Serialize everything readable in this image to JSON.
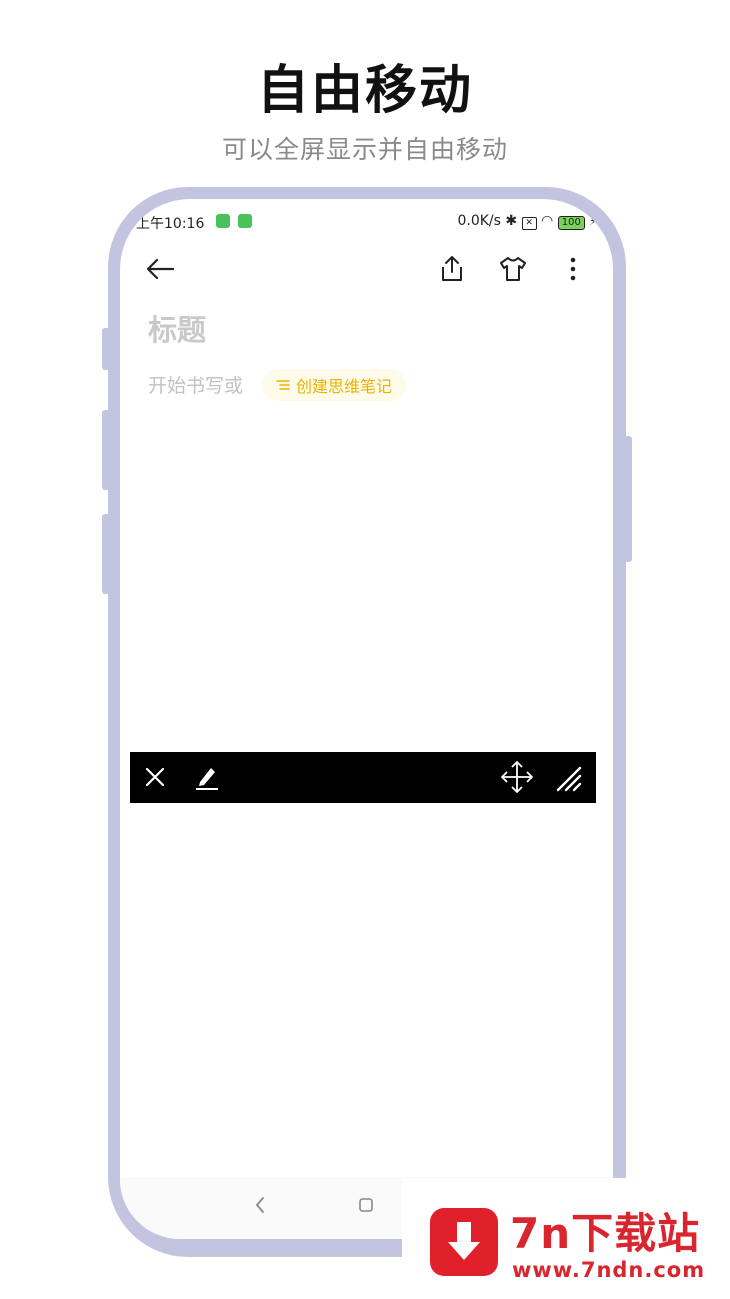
{
  "hero": {
    "title": "自由移动",
    "subtitle": "可以全屏显示并自由移动"
  },
  "status_bar": {
    "time": "上午10:16",
    "right_text": "0.0K/s",
    "battery": "100"
  },
  "app_bar": {
    "back_icon": "arrow-left-icon",
    "share_icon": "share-icon",
    "theme_icon": "tshirt-icon",
    "more_icon": "more-vertical-icon"
  },
  "note": {
    "title_placeholder": "标题",
    "body_placeholder": "开始书写或",
    "mind_map_button": "创建思维笔记"
  },
  "floating_toolbar": {
    "close_icon": "close-icon",
    "pen_icon": "pen-icon",
    "move_icon": "move-icon",
    "resize_icon": "resize-icon"
  },
  "watermark": {
    "brand": "7n下载站",
    "url": "www.7ndn.com"
  },
  "colors": {
    "frame": "#c3c5e0",
    "chip_text": "#e8b400",
    "watermark_red": "#d9252e"
  }
}
